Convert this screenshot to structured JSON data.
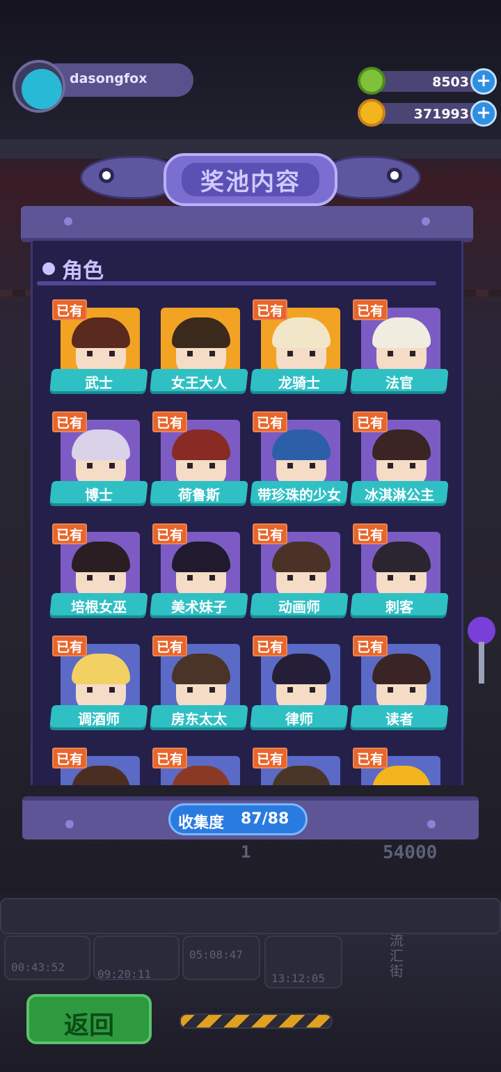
{
  "profile": {
    "username": "dasongfox"
  },
  "currencies": [
    {
      "name": "green-coin",
      "amount": "8503",
      "color": "#7fc23a"
    },
    {
      "name": "gold-coin",
      "amount": "371993",
      "color": "#f2b51d"
    }
  ],
  "panel": {
    "title": "奖池内容",
    "section_title": "角色",
    "owned_badge": "已有",
    "progress_label": "收集度",
    "progress_value": "87/88"
  },
  "characters": [
    {
      "name": "武士",
      "owned": true,
      "bg": "orange",
      "hair": "#5a2a1e"
    },
    {
      "name": "女王大人",
      "owned": false,
      "bg": "orange",
      "hair": "#3b2a1c"
    },
    {
      "name": "龙骑士",
      "owned": true,
      "bg": "orange",
      "hair": "#f2e6c8"
    },
    {
      "name": "法官",
      "owned": true,
      "bg": "purple",
      "hair": "#f1ece0"
    },
    {
      "name": "博士",
      "owned": true,
      "bg": "purple",
      "hair": "#d9d2e8"
    },
    {
      "name": "荷鲁斯",
      "owned": true,
      "bg": "purple",
      "hair": "#8a2a24"
    },
    {
      "name": "带珍珠的少女",
      "owned": true,
      "bg": "purple",
      "hair": "#2d5fa8"
    },
    {
      "name": "冰淇淋公主",
      "owned": true,
      "bg": "purple",
      "hair": "#3a2424"
    },
    {
      "name": "培根女巫",
      "owned": true,
      "bg": "purple",
      "hair": "#2a1e22"
    },
    {
      "name": "美术妹子",
      "owned": true,
      "bg": "purple",
      "hair": "#1f1a2e"
    },
    {
      "name": "动画师",
      "owned": true,
      "bg": "purple",
      "hair": "#4a3326"
    },
    {
      "name": "刺客",
      "owned": true,
      "bg": "purple",
      "hair": "#2a2530"
    },
    {
      "name": "调酒师",
      "owned": true,
      "bg": "blue",
      "hair": "#f2d064"
    },
    {
      "name": "房东太太",
      "owned": true,
      "bg": "blue",
      "hair": "#4a3428"
    },
    {
      "name": "律师",
      "owned": true,
      "bg": "blue",
      "hair": "#241f36"
    },
    {
      "name": "读者",
      "owned": true,
      "bg": "blue",
      "hair": "#3a2426"
    },
    {
      "name": "",
      "owned": true,
      "bg": "blue",
      "hair": "#4a2e22"
    },
    {
      "name": "",
      "owned": true,
      "bg": "blue",
      "hair": "#8a3a24"
    },
    {
      "name": "",
      "owned": true,
      "bg": "blue",
      "hair": "#4a3628"
    },
    {
      "name": "",
      "owned": true,
      "bg": "blue",
      "hair": "#f2b51d"
    }
  ],
  "footer": {
    "back_label": "返回"
  },
  "background": {
    "timers": [
      "00:43:52",
      "09:20:11",
      "05:08:47",
      "13:12:05"
    ],
    "coin_count": "1",
    "coin_total": "54000",
    "street_label": "流汇街"
  }
}
